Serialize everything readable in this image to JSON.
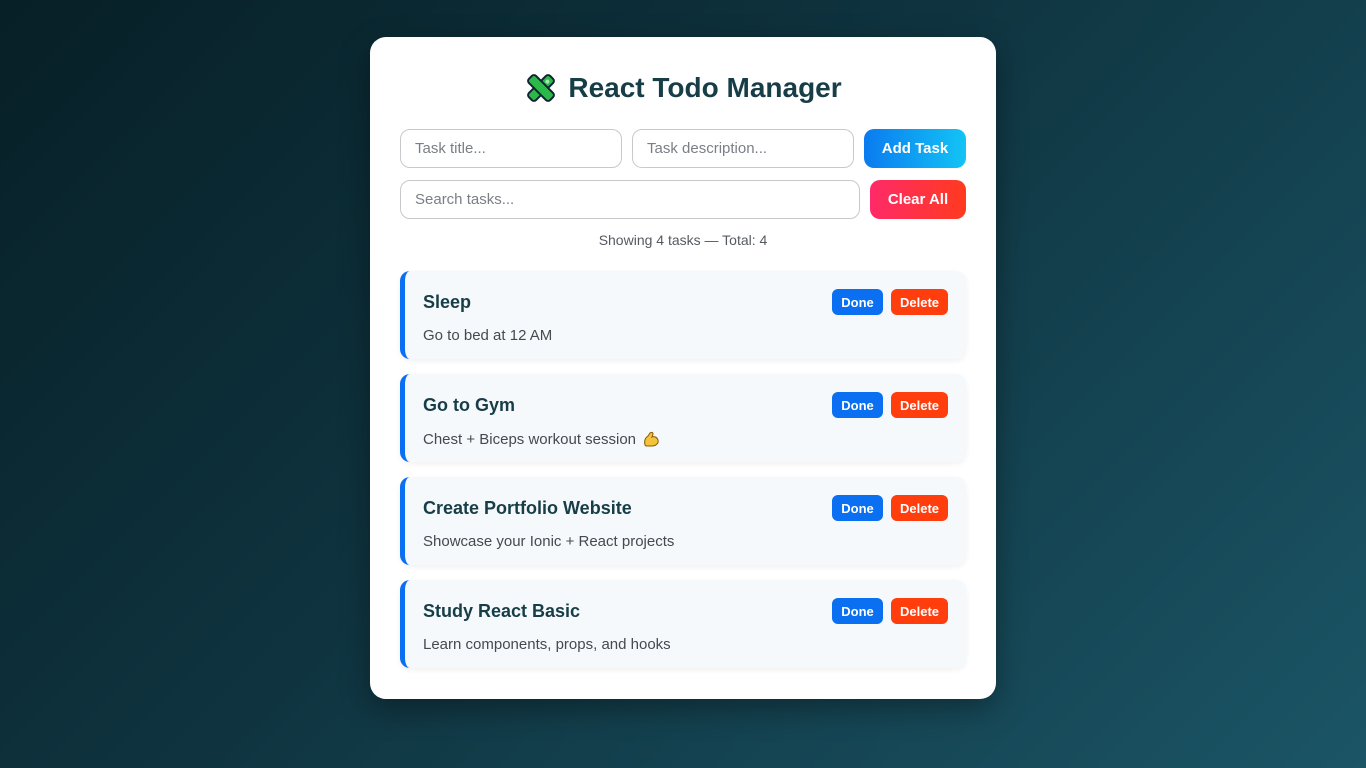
{
  "app": {
    "title": "React Todo Manager",
    "title_icon": "puzzle-cross-icon"
  },
  "form": {
    "title_placeholder": "Task title...",
    "description_placeholder": "Task description...",
    "add_label": "Add Task",
    "search_placeholder": "Search tasks...",
    "clear_label": "Clear All"
  },
  "summary": "Showing 4 tasks — Total: 4",
  "tasks": [
    {
      "title": "Sleep",
      "description": "Go to bed at 12 AM",
      "done_label": "Done",
      "delete_label": "Delete"
    },
    {
      "title": "Go to Gym",
      "description": "Chest + Biceps workout session",
      "emoji": "flexed-biceps-icon",
      "done_label": "Done",
      "delete_label": "Delete"
    },
    {
      "title": "Create Portfolio Website",
      "description": "Showcase your Ionic + React projects",
      "done_label": "Done",
      "delete_label": "Delete"
    },
    {
      "title": "Study React Basic",
      "description": "Learn components, props, and hooks",
      "done_label": "Done",
      "delete_label": "Delete"
    }
  ],
  "colors": {
    "accent": "#0a6ff0",
    "danger": "#ff3d0d",
    "heading": "#173d47"
  }
}
